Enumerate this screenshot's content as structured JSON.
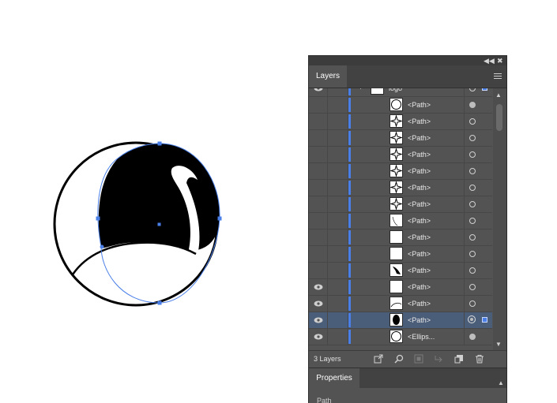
{
  "panel": {
    "collapse_icon": "double-chevron-left-icon",
    "close_icon": "close-icon",
    "layers_tab_label": "Layers",
    "menu_icon": "hamburger-menu-icon",
    "layer_group_name": "logo",
    "rows": [
      {
        "name": "<Path>",
        "visible": false,
        "thumb": "circle-outline",
        "target": "filled"
      },
      {
        "name": "<Path>",
        "visible": false,
        "thumb": "sparkle",
        "target": "empty"
      },
      {
        "name": "<Path>",
        "visible": false,
        "thumb": "sparkle",
        "target": "empty"
      },
      {
        "name": "<Path>",
        "visible": false,
        "thumb": "sparkle",
        "target": "empty"
      },
      {
        "name": "<Path>",
        "visible": false,
        "thumb": "sparkle",
        "target": "empty"
      },
      {
        "name": "<Path>",
        "visible": false,
        "thumb": "sparkle",
        "target": "empty"
      },
      {
        "name": "<Path>",
        "visible": false,
        "thumb": "sparkle",
        "target": "empty"
      },
      {
        "name": "<Path>",
        "visible": false,
        "thumb": "thin-curve",
        "target": "empty"
      },
      {
        "name": "<Path>",
        "visible": false,
        "thumb": "blank",
        "target": "empty"
      },
      {
        "name": "<Path>",
        "visible": false,
        "thumb": "blank",
        "target": "empty"
      },
      {
        "name": "<Path>",
        "visible": false,
        "thumb": "swan-neck",
        "target": "empty"
      },
      {
        "name": "<Path>",
        "visible": true,
        "thumb": "blank",
        "target": "empty"
      },
      {
        "name": "<Path>",
        "visible": true,
        "thumb": "arc",
        "target": "empty"
      },
      {
        "name": "<Path>",
        "visible": true,
        "thumb": "filled-ellipse",
        "target": "selected",
        "selected": true
      },
      {
        "name": "<Ellips...",
        "visible": true,
        "thumb": "circle-outline",
        "target": "filled"
      }
    ],
    "layer_count": "3 Layers",
    "footer_icons": [
      "export-icon",
      "search-icon",
      "clipping-mask-icon",
      "sublayer-icon",
      "new-layer-icon",
      "trash-icon"
    ],
    "properties_tab_label": "Properties",
    "properties_path_label": "Path"
  },
  "colors": {
    "panel_bg": "#535353",
    "selection_blue": "#4a7fe8",
    "selected_row": "#4b5e79"
  }
}
